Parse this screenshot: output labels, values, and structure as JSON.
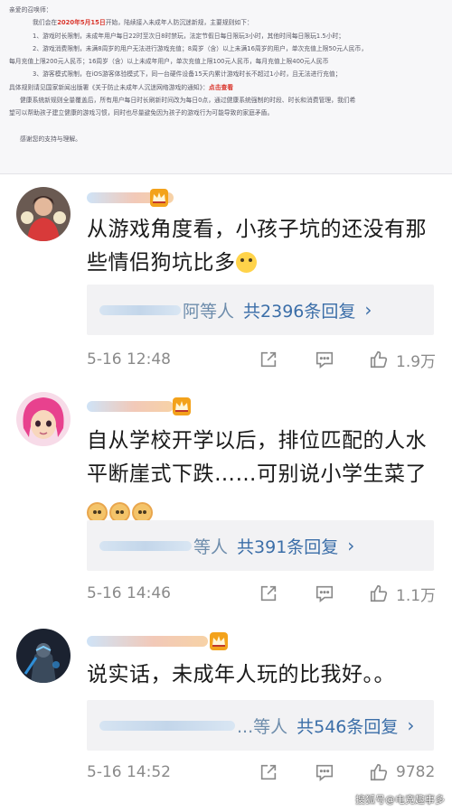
{
  "notice": {
    "greeting": "亲爱的召唤师：",
    "lines": [
      {
        "pre": "我们会在",
        "red": "2020年5月15日",
        "post": "开始，陆续接入未成年人防沉迷新规，主要规则如下：",
        "indent": 1
      },
      {
        "pre": "1、游戏时长限制，未成年用户每日22时至次日8时禁玩，法定节假日每日限玩3小时，其他时间每日限玩1.5小时；",
        "red": "",
        "post": "",
        "indent": 1
      },
      {
        "pre": "2、游戏消费限制，未满8周岁的用户无法进行游戏充值；8周岁（含）以上未满16周岁的用户，单次充值上限50元人民币，",
        "red": "",
        "post": "",
        "indent": 1
      },
      {
        "pre": "每月充值上限200元人民币；16周岁（含）以上未成年用户，单次充值上限100元人民币，每月充值上限400元人民币",
        "red": "",
        "post": "",
        "indent": 0
      },
      {
        "pre": "3、游客模式限制，在iOS游客体验模式下，同一台硬件设备15天内累计游戏时长不超过1小时，且无法进行充值；",
        "red": "",
        "post": "",
        "indent": 1
      },
      {
        "pre": "具体规则请见国家新闻出版署《关于防止未成年人沉迷网络游戏的通知》：",
        "red": "点击查看",
        "post": "",
        "indent": 0
      },
      {
        "pre": "健康系统新规则全量覆盖后，所有用户每日时长刷新时间改为每日0点，通过健康系统强制的时段、时长和消费管理，我们希",
        "red": "",
        "post": "",
        "indent": 2
      },
      {
        "pre": "望可以帮助孩子建立健康的游戏习惯，同时也尽量避免因为孩子的游戏行为可能导致的家庭矛盾。",
        "red": "",
        "post": "",
        "indent": 0
      },
      {
        "pre": "",
        "red": "",
        "post": "",
        "indent": 0
      },
      {
        "pre": "感谢您的支持与理解。",
        "red": "",
        "post": "",
        "indent": 2
      }
    ]
  },
  "comments": [
    {
      "avatar": "avatar-cheerleader",
      "text_line1": "从游戏角度看，小孩子坑的还没有那",
      "text_line2": "些情侣狗坑比多",
      "emoji": [
        "eye-roll-emoji"
      ],
      "reply_name": "阿等人",
      "reply_count": "共2396条回复",
      "reply_chevron": "›",
      "time": "5-16 12:48",
      "likes": "1.9万"
    },
    {
      "avatar": "avatar-pink-hair",
      "text_line1": "自从学校开学以后，排位匹配的人水",
      "text_line2": "平断崖式下跌……可别说小学生菜了",
      "emoji": [
        "doge-emoji",
        "doge-emoji",
        "doge-emoji"
      ],
      "reply_name": "等人",
      "reply_count": "共391条回复",
      "reply_chevron": "›",
      "time": "5-16 14:46",
      "likes": "1.1万"
    },
    {
      "avatar": "avatar-dark-warrior",
      "text_line1": "说实话，未成年人玩的比我好。。",
      "text_line2": "",
      "emoji": [],
      "reply_name": "...等人",
      "reply_count": "共546条回复",
      "reply_chevron": "›",
      "time": "5-16 14:52",
      "likes": "9782"
    }
  ],
  "watermark": "搜狐号@电竞趣事多",
  "colors": {
    "accent_red": "#d9342b",
    "link_blue": "#3b6ea8",
    "vip_gold": "#f3a21b"
  }
}
